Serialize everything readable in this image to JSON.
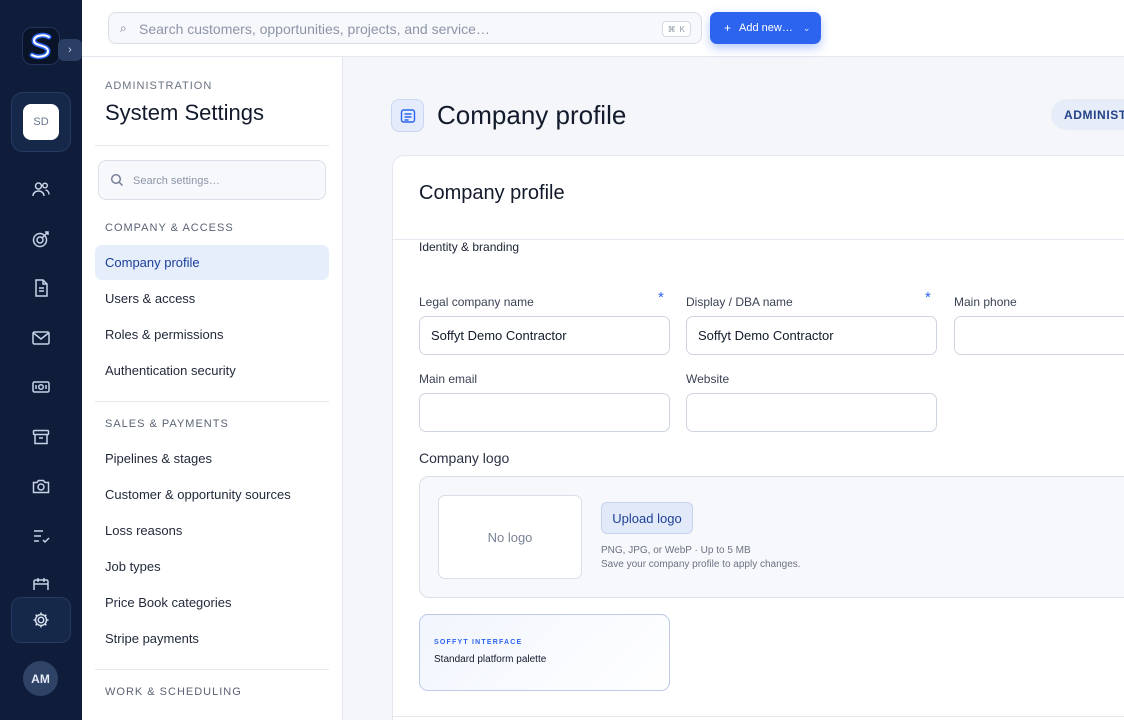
{
  "search": {
    "placeholder": "Search customers, opportunities, projects, and service…",
    "shortcut_mod": "⌘",
    "shortcut_key": "K"
  },
  "add_button": {
    "label": "Add new…"
  },
  "rail": {
    "workspace_initials": "SD",
    "user_initials": "AM",
    "brand_color": "#2c64f0",
    "icons": [
      "users-icon",
      "target-icon",
      "document-icon",
      "mail-icon",
      "money-icon",
      "archive-icon",
      "camera-icon",
      "checklist-icon",
      "calendar-icon"
    ]
  },
  "settings_nav": {
    "eyebrow": "ADMINISTRATION",
    "title": "System Settings",
    "search_placeholder": "Search settings…",
    "sections": [
      {
        "title": "COMPANY & ACCESS",
        "items": [
          "Company profile",
          "Users & access",
          "Roles & permissions",
          "Authentication security"
        ]
      },
      {
        "title": "SALES & PAYMENTS",
        "items": [
          "Pipelines & stages",
          "Customer & opportunity sources",
          "Loss reasons",
          "Job types",
          "Price Book categories",
          "Stripe payments"
        ]
      },
      {
        "title": "WORK & SCHEDULING",
        "items": []
      }
    ]
  },
  "main": {
    "title": "Company profile",
    "admin_badge": "ADMINISTRATION",
    "card": {
      "title": "Company profile",
      "section_identity": "Identity & branding",
      "fields": {
        "legal_name_label": "Legal company name",
        "legal_name_value": "Soffyt Demo Contractor",
        "display_name_label": "Display / DBA name",
        "display_name_value": "Soffyt Demo Contractor",
        "main_phone_label": "Main phone",
        "main_phone_value": "",
        "main_email_label": "Main email",
        "main_email_value": "",
        "website_label": "Website",
        "website_value": "",
        "required_marker": "*"
      },
      "logo": {
        "heading": "Company logo",
        "empty_text": "No logo",
        "upload_label": "Upload logo",
        "hint_formats": "PNG, JPG, or WebP · Up to 5 MB",
        "hint_save": "Save your company profile to apply changes."
      },
      "palette": {
        "eyebrow": "SOFFYT INTERFACE",
        "name": "Standard platform palette"
      }
    }
  }
}
